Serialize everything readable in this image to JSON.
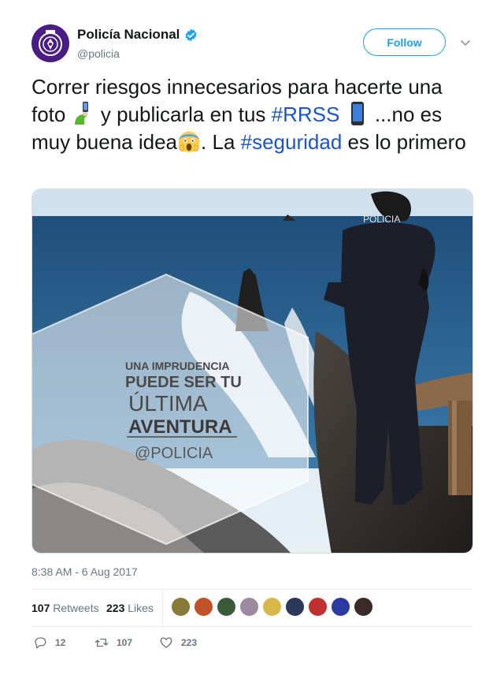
{
  "author": {
    "display_name": "Policía Nacional",
    "handle": "@policia",
    "verified": true,
    "avatar_color": "#4a1d86"
  },
  "follow_label": "Follow",
  "tweet": {
    "text_1": "Correr riesgos innecesarios para hacerte una foto",
    "text_2": " y publicarla en tus ",
    "tag_1": "#RRSS",
    "text_3": " ...no es muy buena idea",
    "text_4": ". La ",
    "tag_2": "#seguridad",
    "text_5": " es lo primero",
    "link_color": "#1b55c7"
  },
  "media": {
    "overlay_lines": [
      "UNA IMPRUDENCIA",
      "PUEDE SER TU",
      "ÚLTIMA",
      "AVENTURA",
      "@POLICIA"
    ],
    "uniform_text": "POLICIA"
  },
  "timestamp": "8:38 AM - 6 Aug 2017",
  "stats": {
    "retweets_count": "107",
    "retweets_label": "Retweets",
    "likes_count": "223",
    "likes_label": "Likes"
  },
  "likers": [
    "#8a7a3a",
    "#c0522a",
    "#3b5a3a",
    "#9a8aa0",
    "#d8b84a",
    "#2c3a5a",
    "#c03030",
    "#2a3aa0",
    "#3a2a2a"
  ],
  "actions": {
    "reply_count": "12",
    "retweet_count": "107",
    "like_count": "223"
  }
}
